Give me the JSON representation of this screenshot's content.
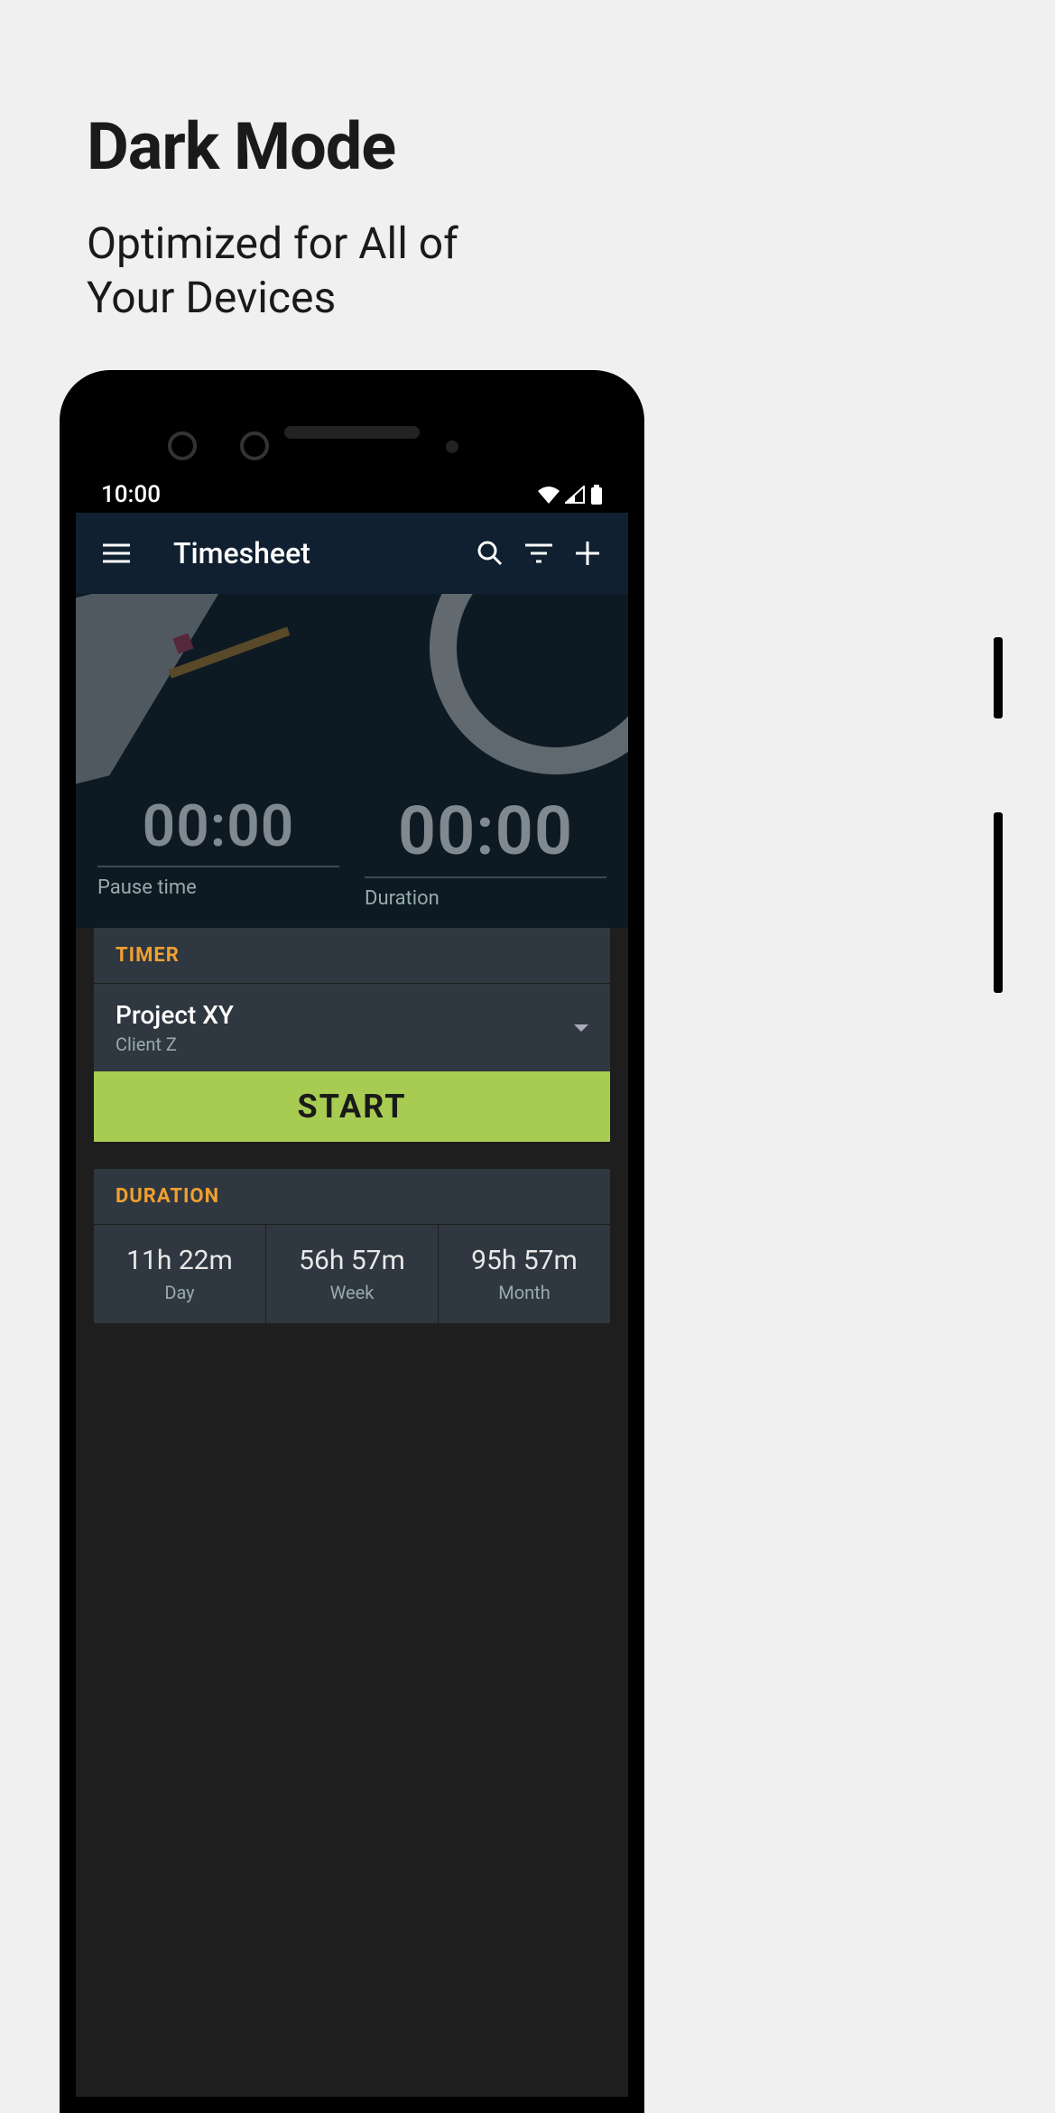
{
  "promo": {
    "title": "Dark Mode",
    "subtitle_line1": "Optimized for All of",
    "subtitle_line2": "Your Devices"
  },
  "status": {
    "time": "10:00"
  },
  "appbar": {
    "title": "Timesheet"
  },
  "timers": {
    "pause_value": "00:00",
    "pause_label": "Pause time",
    "duration_value": "00:00",
    "duration_label": "Duration"
  },
  "timer_card": {
    "header": "TIMER",
    "project_name": "Project XY",
    "client_name": "Client Z",
    "start_label": "START"
  },
  "duration_card": {
    "header": "DURATION",
    "cells": [
      {
        "value": "11h 22m",
        "label": "Day"
      },
      {
        "value": "56h 57m",
        "label": "Week"
      },
      {
        "value": "95h 57m",
        "label": "Month"
      }
    ]
  }
}
